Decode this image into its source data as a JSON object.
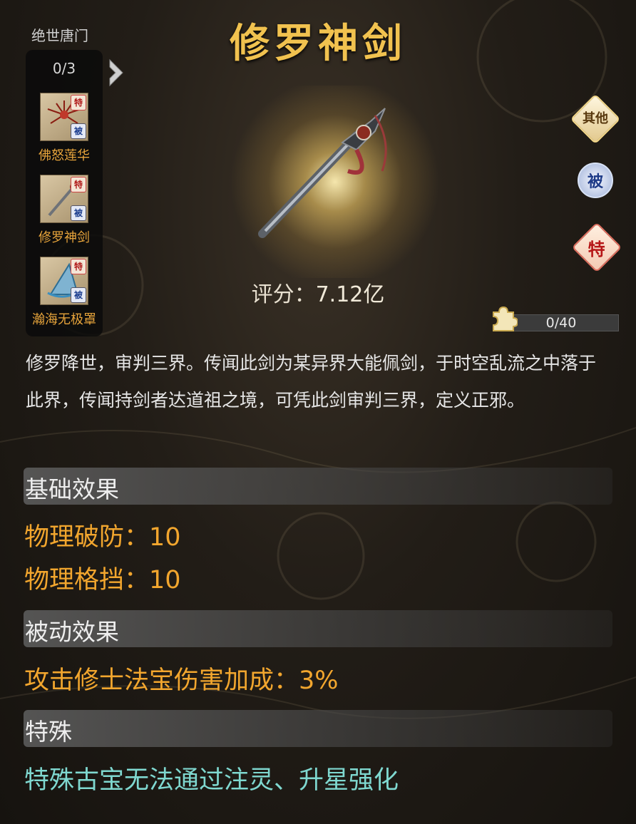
{
  "set": {
    "title": "绝世唐门",
    "count": "0/3",
    "items": [
      {
        "name": "佛怒莲华",
        "tag_special": "特",
        "tag_passive": "被"
      },
      {
        "name": "修罗神剑",
        "tag_special": "特",
        "tag_passive": "被"
      },
      {
        "name": "瀚海无极罩",
        "tag_special": "特",
        "tag_passive": "被"
      }
    ]
  },
  "item": {
    "name": "修罗神剑",
    "score_label": "评分：",
    "score_value": "7.12亿",
    "fragments": "0/40",
    "description": "修罗降世，审判三界。传闻此剑为某异界大能佩剑，于时空乱流之中落于此界，传闻持剑者达道祖之境，可凭此剑审判三界，定义正邪。"
  },
  "side_buttons": {
    "other": "其他",
    "passive": "被",
    "special": "特"
  },
  "sections": {
    "basic": {
      "header": "基础效果",
      "lines": [
        "物理破防：10",
        "物理格挡：10"
      ]
    },
    "passive": {
      "header": "被动效果",
      "lines": [
        "攻击修士法宝伤害加成：3%"
      ]
    },
    "special": {
      "header": "特殊",
      "lines": [
        "特殊古宝无法通过注灵、升星强化"
      ]
    }
  },
  "colors": {
    "title_gold": "#f1c24f",
    "effect_gold": "#f2a62e",
    "special_teal": "#7fd8d0"
  }
}
